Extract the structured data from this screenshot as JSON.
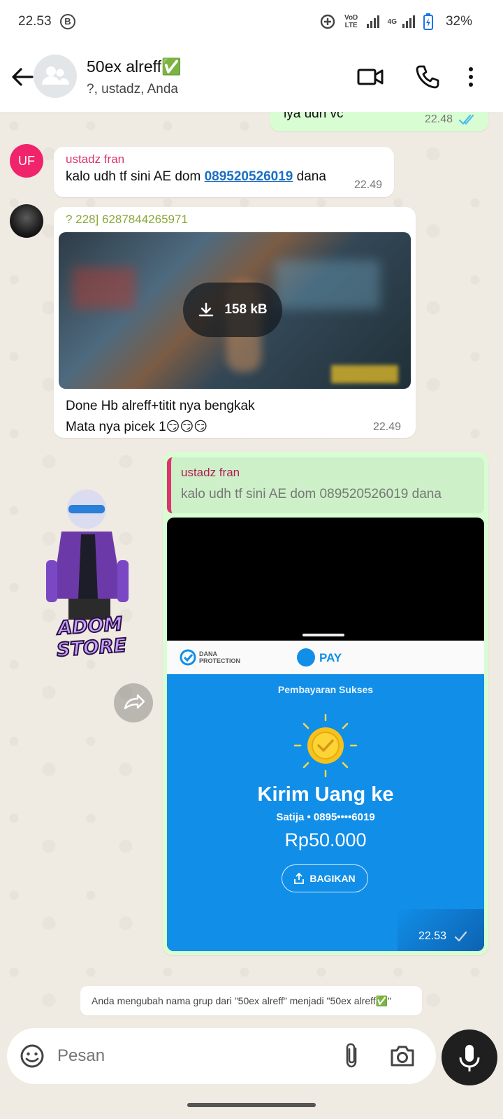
{
  "status_bar": {
    "time": "22.53",
    "b_badge": "B",
    "network_label": "VoD LTE",
    "net_4g": "4G",
    "battery": "32%"
  },
  "header": {
    "title": "50ex alreff✅",
    "subtitle": "?, ustadz, Anda"
  },
  "messages": {
    "m1": {
      "text": "iya udh vc",
      "time": "22.48"
    },
    "m2": {
      "avatar_initials": "UF",
      "sender": "ustadz fran",
      "text_before": "kalo udh tf sini AE dom ",
      "phone": "089520526019",
      "text_after": " dana",
      "time": "22.49"
    },
    "m3": {
      "sender": "? 228] 6287844265971",
      "file_size": "158 kB",
      "line1": "Done Hb alreff+titit nya bengkak",
      "line2": "Mata nya picek 1😏😏😏",
      "time": "22.49"
    },
    "sticker": {
      "label": "ADOM STORE"
    },
    "m4": {
      "quote_sender": "ustadz fran",
      "quote_text": "kalo udh tf sini AE dom 089520526019 dana",
      "time": "22.53",
      "receipt": {
        "dana_protection_line1": "DANA",
        "dana_protection_line2": "PROTECTION",
        "pay_label": "PAY",
        "status": "Pembayaran Sukses",
        "heading": "Kirim Uang ke",
        "recipient": "Satija • 0895••••6019",
        "amount": "Rp50.000",
        "share_button": "BAGIKAN"
      }
    },
    "system": {
      "text": "Anda mengubah nama grup dari \"50ex alreff\" menjadi \"50ex alreff✅\""
    }
  },
  "input": {
    "placeholder": "Pesan"
  },
  "colors": {
    "header_bg": "#ffffff",
    "chat_bg": "#efeae2",
    "outgoing_bubble": "#d9fdd3",
    "incoming_bubble": "#ffffff",
    "sender_pink": "#e0336d",
    "sender_green": "#8aa83a",
    "dana_blue": "#118ee8",
    "read_tick_blue": "#53bdeb"
  },
  "icons": [
    "back-arrow-icon",
    "group-avatar-icon",
    "video-call-icon",
    "phone-icon",
    "more-vert-icon",
    "double-check-icon",
    "download-icon",
    "forward-icon",
    "single-check-icon",
    "emoji-icon",
    "attach-icon",
    "camera-icon",
    "mic-icon"
  ]
}
